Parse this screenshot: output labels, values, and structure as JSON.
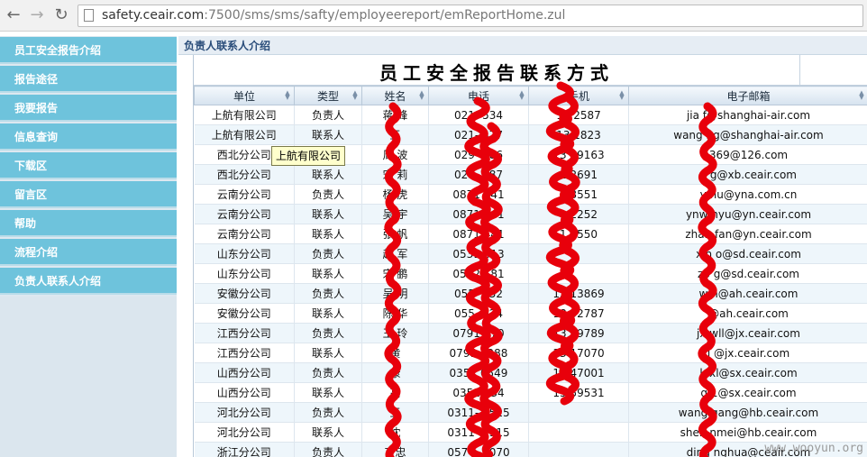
{
  "browser": {
    "url_host": "safety.ceair.com",
    "url_path": ":7500/sms/sms/safty/employeereport/emReportHome.zul",
    "back_icon": "arrow-left-icon",
    "forward_icon": "arrow-right-icon",
    "reload_icon": "reload-icon"
  },
  "sidebar": {
    "items": [
      {
        "label": "员工安全报告介绍"
      },
      {
        "label": "报告途径"
      },
      {
        "label": "我要报告"
      },
      {
        "label": "信息查询"
      },
      {
        "label": "下载区"
      },
      {
        "label": "留言区"
      },
      {
        "label": "帮助"
      },
      {
        "label": "流程介绍"
      },
      {
        "label": "负责人联系人介绍"
      }
    ]
  },
  "panel": {
    "title": "负责人联系人介绍"
  },
  "grid": {
    "caption": "员工安全报告联系方式",
    "columns": [
      "单位",
      "类型",
      "姓名",
      "电话",
      "手机",
      "电子邮箱"
    ],
    "rows": [
      [
        "上航有限公司",
        "负责人",
        "蒋  峰",
        "021-   534",
        "13   2587",
        "jia    f@shanghai-air.com"
      ],
      [
        "上航有限公司",
        "联系人",
        "王  ",
        "021-   577",
        "13   1823",
        "wang    ng@shanghai-air.com"
      ],
      [
        "西北分公司",
        "负责人",
        "周  波",
        "029-   086",
        "13   29163",
        "    369@126.com"
      ],
      [
        "西北分公司",
        "联系人",
        "宋  莉",
        "029-   087",
        "1    2691",
        "x    g@xb.ceair.com"
      ],
      [
        "云南分公司",
        "负责人",
        "杨  虎",
        "0871   441",
        "1    3551",
        "y    hu@yna.com.cn"
      ],
      [
        "云南分公司",
        "联系人",
        "吴  宇",
        "0871   441",
        "1    2252",
        "ynw    nyu@yn.ceair.com"
      ],
      [
        "云南分公司",
        "联系人",
        "张  帆",
        "0871   441",
        "1    7550",
        "zhan    fan@yn.ceair.com"
      ],
      [
        "山东分公司",
        "负责人",
        "赵  军",
        "0531   013",
        "",
        "xin    o@sd.ceair.com"
      ],
      [
        "山东分公司",
        "联系人",
        "宋  鹏",
        "0532   181",
        "",
        "zp    g@sd.ceair.com"
      ],
      [
        "安徽分公司",
        "负责人",
        "吴  明",
        "055-   452",
        "13   13869",
        "w    n@ah.ceair.com"
      ],
      [
        "安徽分公司",
        "联系人",
        "陈  华",
        "055-   924",
        "18   52787",
        "    @ah.ceair.com"
      ],
      [
        "江西分公司",
        "负责人",
        "王  玲",
        "0791   070",
        "13   19789",
        "jx    wll@jx.ceair.com"
      ],
      [
        "江西分公司",
        "联系人",
        "黄  ",
        "0791   1288",
        "13   17070",
        "j    @jx.ceair.com"
      ],
      [
        "山西分公司",
        "负责人",
        "康  ",
        "0351   6549",
        "13   47001",
        "k    xl@sx.ceair.com"
      ],
      [
        "山西分公司",
        "联系人",
        "高  ",
        "0351   134",
        "15   59531",
        "g    1@sx.ceair.com"
      ],
      [
        "河北分公司",
        "负责人",
        "王  ",
        "0311-   1515",
        "",
        "wang    gang@hb.ceair.com"
      ],
      [
        "河北分公司",
        "联系人",
        "沈  ",
        "0311-   1515",
        "",
        "shen    nmei@hb.ceair.com"
      ],
      [
        "浙江分公司",
        "负责人",
        "丁忠  ",
        "0574-   3070",
        "",
        "ding    nghua@ceair.com"
      ]
    ]
  },
  "tooltip": {
    "text": "上航有限公司"
  },
  "watermark": "www.wooyun.org",
  "colors": {
    "sidebar_item": "#6ec3dc",
    "redaction": "#e8000b"
  }
}
